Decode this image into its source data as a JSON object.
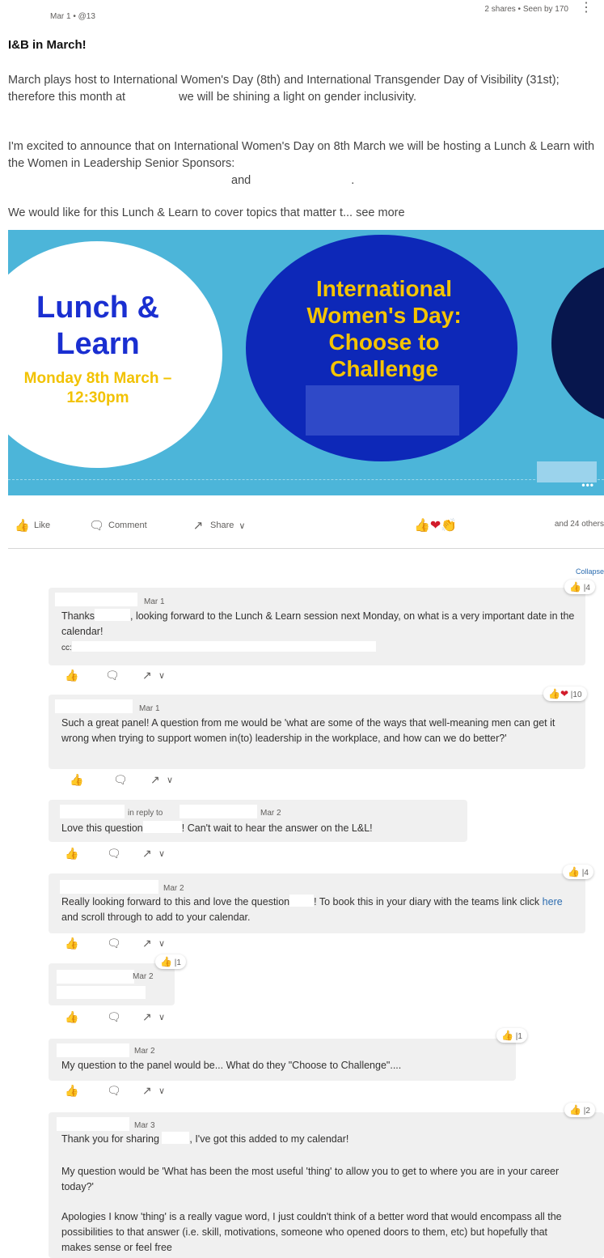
{
  "post": {
    "meta": "Mar 1  •  @13",
    "stats": "2 shares  •  Seen by 170",
    "more": "⋮",
    "title": "I&B in March!",
    "p1a": "March plays host to International Women's Day (8th) and International Transgender Day of Visibility (31st); therefore this month at",
    "p1b": "we will be shining a light on gender inclusivity.",
    "p2": "I'm excited to announce that on International Women's Day on 8th March we will be hosting a Lunch & Learn with the Women in Leadership Senior Sponsors:",
    "p2_and": "and",
    "p2_end": ".",
    "p3": "We would like for this Lunch & Learn to cover topics that matter t...",
    "see_more": "see more"
  },
  "banner": {
    "lunch_title": "Lunch & Learn",
    "lunch_date": "Monday 8th March – 12:30pm",
    "iwd_title": "International Women's Day: Choose to Challenge",
    "dots": "•••"
  },
  "actions": {
    "like": "Like",
    "comment": "Comment",
    "share": "Share",
    "others": "and 24 others",
    "collapse": "Collapse"
  },
  "icons": {
    "like": "👍",
    "heart": "❤",
    "clap": "👏",
    "comment": "🗨",
    "share": "↗",
    "chevron": "∨"
  },
  "comments": [
    {
      "date": "Mar 1",
      "line1a": "Thanks",
      "line1b": ", looking forward to the Lunch & Learn session next Monday, on what is a very important date in the calendar!",
      "cc": "cc:",
      "reaction_count": "4"
    },
    {
      "date": "Mar 1",
      "text": "Such a great panel! A question from me would be 'what are some of the ways that well-meaning men can get it wrong when trying to support women in(to) leadership in the workplace, and how can we do better?'",
      "reaction_count": "10"
    },
    {
      "in_reply_to": "in reply to",
      "date": "Mar 2",
      "text_a": "Love this question",
      "text_b": "! Can't wait to hear the answer on the L&L!"
    },
    {
      "date": "Mar 2",
      "text_a": "Really looking forward to this and love the question",
      "text_b": "! To book this in your diary with the teams link click",
      "link": "here",
      "text_c": "and scroll through to add to your calendar.",
      "reaction_count": "4"
    },
    {
      "date": "Mar 2",
      "reaction_count": "1"
    },
    {
      "date": "Mar 2",
      "text": "My question to the panel would be... What do they \"Choose to Challenge\"....",
      "reaction_count": "1"
    },
    {
      "date": "Mar 3",
      "text_a": "Thank you for sharing",
      "text_b": ", I've got this added to my calendar!",
      "text_p2": "My question would be 'What has been the most useful 'thing' to allow you to get to where you are in your career today?'",
      "text_p3": "Apologies I know 'thing' is a really vague word, I just couldn't think of a better word that would encompass all the possibilities to that answer (i.e. skill, motivations, someone who opened doors to them, etc) but hopefully that makes sense or feel free",
      "reaction_count": "2"
    }
  ]
}
